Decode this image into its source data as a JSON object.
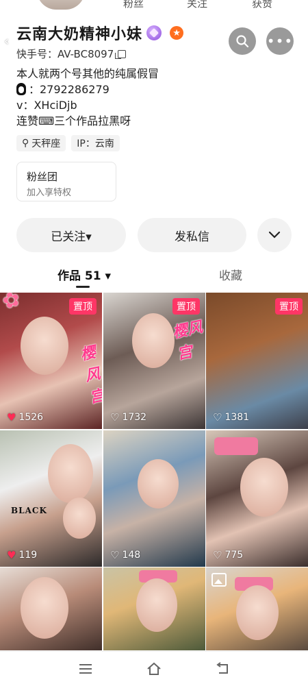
{
  "header": {
    "stats": [
      {
        "label": "粉丝"
      },
      {
        "label": "关注"
      },
      {
        "label": "获赞"
      }
    ],
    "name": "云南大奶精神小妹",
    "handle": "快手号：AV-BC8097"
  },
  "bio": {
    "line1": "本人就两个号其他的纯属假冒",
    "qq": "：2792286279",
    "wechat": "v：XHciDjb",
    "line4": "连赞⌨三个作品拉黑呀"
  },
  "tags": [
    {
      "icon": "⚲",
      "label": "天秤座"
    },
    {
      "label": "IP：云南"
    }
  ],
  "fan_club": {
    "title": "粉丝团",
    "subtitle": "加入享特权"
  },
  "actions": {
    "followed": "已关注▾",
    "message": "发私信",
    "expand": "⌄"
  },
  "tabs": {
    "works": "作品 51 ▾",
    "collect": "收藏"
  },
  "works": [
    {
      "pinned": true,
      "pin_label": "置顶",
      "likes": "1526",
      "liked": true,
      "watermark": "樱风宫"
    },
    {
      "pinned": true,
      "pin_label": "置顶",
      "likes": "1732",
      "liked": false,
      "watermark": "樱风宫"
    },
    {
      "pinned": true,
      "pin_label": "置顶",
      "likes": "1381",
      "liked": false
    },
    {
      "pinned": false,
      "likes": "119",
      "liked": true,
      "overlay_text": "BLACK"
    },
    {
      "pinned": false,
      "likes": "148",
      "liked": false
    },
    {
      "pinned": false,
      "likes": "775",
      "liked": false
    },
    {
      "pinned": false
    },
    {
      "pinned": false
    },
    {
      "pinned": false,
      "image_type": "photo"
    }
  ],
  "colors": {
    "accent": "#fe3666",
    "like_red": "#fe2c55"
  }
}
